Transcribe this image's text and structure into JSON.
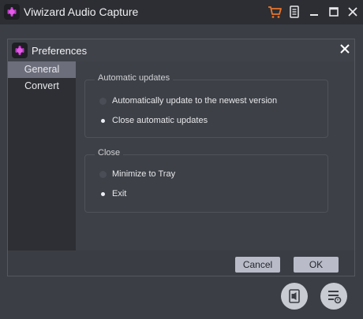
{
  "app": {
    "title": "Viwizard Audio Capture"
  },
  "titlebar": {
    "icons": [
      "cart-icon",
      "menu-icon",
      "minimize-icon",
      "maximize-icon",
      "close-icon"
    ],
    "accent": "#e8742b"
  },
  "dialog": {
    "title": "Preferences",
    "nav": [
      {
        "label": "General",
        "active": true
      },
      {
        "label": "Convert",
        "active": false
      }
    ],
    "auto_updates": {
      "legend": "Automatic updates",
      "options": [
        {
          "label": "Automatically update to the newest version",
          "checked": false
        },
        {
          "label": "Close automatic updates",
          "checked": true
        }
      ]
    },
    "close_group": {
      "legend": "Close",
      "options": [
        {
          "label": "Minimize to Tray",
          "checked": false
        },
        {
          "label": "Exit",
          "checked": true
        }
      ]
    },
    "buttons": {
      "cancel": "Cancel",
      "ok": "OK"
    }
  },
  "bottom_icons": [
    "audio-file-icon",
    "task-list-icon"
  ],
  "colors": {
    "logo": "#c237c9",
    "button": "#b9bcc8",
    "nav_active": "#6c6e7b"
  }
}
